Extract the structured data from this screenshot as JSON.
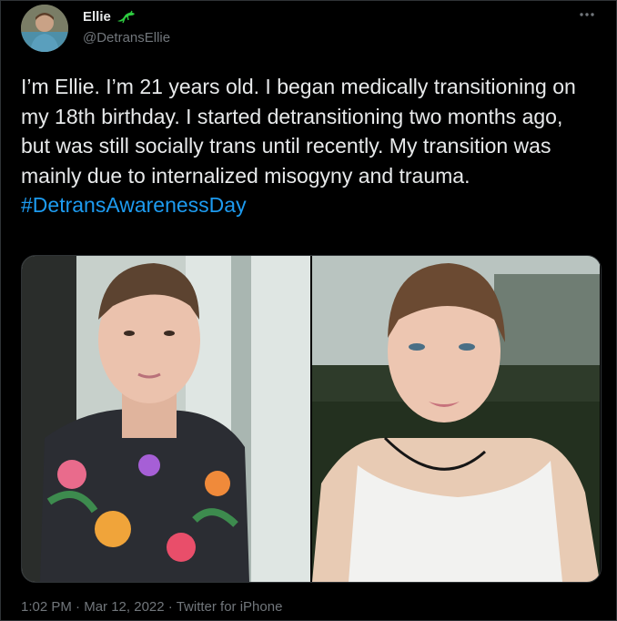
{
  "author": {
    "display_name": "Ellie",
    "handle": "@DetransEllie",
    "badge_icon": "lizard-icon",
    "avatar_icon": "avatar"
  },
  "tweet": {
    "text": "I’m Ellie. I’m 21 years old. I began medically transitioning on my 18th birthday. I started detransitioning two months ago, but was still socially trans until recently. My transition was mainly due to internalized misogyny and trauma.",
    "hashtag": "#DetransAwarenessDay"
  },
  "meta": {
    "time": "1:02 PM",
    "separator": "·",
    "date": "Mar 12, 2022",
    "source": "Twitter for iPhone"
  },
  "colors": {
    "background": "#000000",
    "text": "#e7e9ea",
    "secondary": "#71767b",
    "link": "#1d9bf0",
    "badge": "#2ecc40"
  }
}
